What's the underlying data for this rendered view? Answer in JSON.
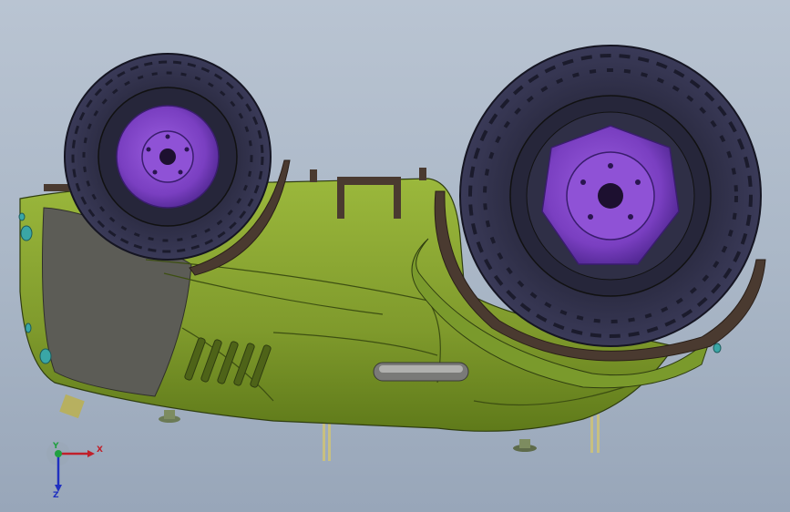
{
  "view": {
    "background_top": "#b9c4d2",
    "background_bottom": "#98a6b9"
  },
  "model": {
    "body_color": "#7f9a2c",
    "body_shadow": "#5f7a1a",
    "panel_color": "#5c5c56",
    "wheel_rim_color": "#7a3fc1",
    "tire_color": "#2c2c44",
    "frame_color": "#4a3a30"
  },
  "triad": {
    "x_label": "X",
    "y_label": "Y",
    "z_label": "Z",
    "x_color": "#c0202a",
    "y_color": "#20a040",
    "z_color": "#2030c0"
  }
}
